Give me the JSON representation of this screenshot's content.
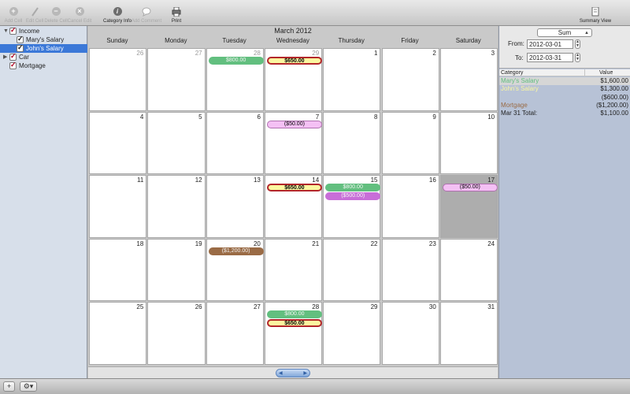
{
  "toolbar": {
    "buttons": [
      {
        "label": "Add Cell",
        "icon": "plus-circle-icon",
        "enabled": false
      },
      {
        "label": "Edit Cell",
        "icon": "pencil-icon",
        "enabled": false
      },
      {
        "label": "Delete Cell",
        "icon": "minus-circle-icon",
        "enabled": false
      },
      {
        "label": "Cancel Edit",
        "icon": "x-circle-icon",
        "enabled": false
      },
      {
        "label": "Category Info",
        "icon": "info-circle-icon",
        "enabled": true
      },
      {
        "label": "Add Comment",
        "icon": "speech-bubble-icon",
        "enabled": false
      },
      {
        "label": "Print",
        "icon": "printer-icon",
        "enabled": true
      }
    ],
    "summary_view_label": "Summary View"
  },
  "sidebar": {
    "items": [
      {
        "label": "Income",
        "level": 0,
        "expanded": true,
        "checked": true,
        "check_color": "#b00020"
      },
      {
        "label": "Mary's Salary",
        "level": 1,
        "checked": true
      },
      {
        "label": "John's Salary",
        "level": 1,
        "checked": true,
        "selected": true
      },
      {
        "label": "Car",
        "level": 0,
        "expanded": false,
        "checked": true,
        "check_color": "#b00020"
      },
      {
        "label": "Mortgage",
        "level": 0,
        "checked": true,
        "check_color": "#b00020"
      }
    ]
  },
  "calendar": {
    "month_title": "March 2012",
    "weekdays": [
      "Sunday",
      "Monday",
      "Tuesday",
      "Wednesday",
      "Thursday",
      "Friday",
      "Saturday"
    ],
    "weeks": [
      [
        {
          "day": "26",
          "other": true,
          "events": []
        },
        {
          "day": "27",
          "other": true,
          "events": []
        },
        {
          "day": "28",
          "other": true,
          "events": [
            {
              "text": "$800.00",
              "style": "green"
            }
          ]
        },
        {
          "day": "29",
          "other": true,
          "events": [
            {
              "text": "$650.00",
              "style": "yellow"
            }
          ]
        },
        {
          "day": "1",
          "events": []
        },
        {
          "day": "2",
          "events": []
        },
        {
          "day": "3",
          "events": []
        }
      ],
      [
        {
          "day": "4",
          "events": []
        },
        {
          "day": "5",
          "events": []
        },
        {
          "day": "6",
          "events": []
        },
        {
          "day": "7",
          "events": [
            {
              "text": "($50.00)",
              "style": "pink"
            }
          ]
        },
        {
          "day": "8",
          "events": []
        },
        {
          "day": "9",
          "events": []
        },
        {
          "day": "10",
          "events": []
        }
      ],
      [
        {
          "day": "11",
          "events": []
        },
        {
          "day": "12",
          "events": []
        },
        {
          "day": "13",
          "events": []
        },
        {
          "day": "14",
          "events": [
            {
              "text": "$650.00",
              "style": "yellow"
            }
          ]
        },
        {
          "day": "15",
          "events": [
            {
              "text": "$800.00",
              "style": "green"
            },
            {
              "text": "($500.00)",
              "style": "purple"
            }
          ]
        },
        {
          "day": "16",
          "events": []
        },
        {
          "day": "17",
          "today": true,
          "events": [
            {
              "text": "($50.00)",
              "style": "pink"
            }
          ]
        }
      ],
      [
        {
          "day": "18",
          "events": []
        },
        {
          "day": "19",
          "events": []
        },
        {
          "day": "20",
          "events": [
            {
              "text": "($1,200.00)",
              "style": "brown"
            }
          ]
        },
        {
          "day": "21",
          "events": []
        },
        {
          "day": "22",
          "events": []
        },
        {
          "day": "23",
          "events": []
        },
        {
          "day": "24",
          "events": []
        }
      ],
      [
        {
          "day": "25",
          "events": []
        },
        {
          "day": "26",
          "events": []
        },
        {
          "day": "27",
          "events": []
        },
        {
          "day": "28",
          "events": [
            {
              "text": "$800.00",
              "style": "green"
            },
            {
              "text": "$650.00",
              "style": "yellow"
            }
          ]
        },
        {
          "day": "29",
          "events": []
        },
        {
          "day": "30",
          "events": []
        },
        {
          "day": "31",
          "events": []
        }
      ]
    ]
  },
  "summary": {
    "mode_select": "Sum",
    "from_label": "From:",
    "from_value": "2012-03-01",
    "to_label": "To:",
    "to_value": "2012-03-31",
    "columns": [
      "Category",
      "Value"
    ],
    "rows": [
      {
        "category": "Mary's Salary",
        "value": "$1,600.00",
        "color": "#62bf7f",
        "highlight": true
      },
      {
        "category": "John's Salary",
        "value": "$1,300.00",
        "color": "#fbf7a0"
      },
      {
        "category": "",
        "value": "($600.00)",
        "color": "#f4c0f4"
      },
      {
        "category": "Mortgage",
        "value": "($1,200.00)",
        "color": "#9a6b45"
      },
      {
        "category": "Mar 31 Total:",
        "value": "$1,100.00",
        "color": "#222222"
      }
    ]
  },
  "bottombar": {
    "add_label": "+",
    "gear_icon": "gear-icon"
  }
}
